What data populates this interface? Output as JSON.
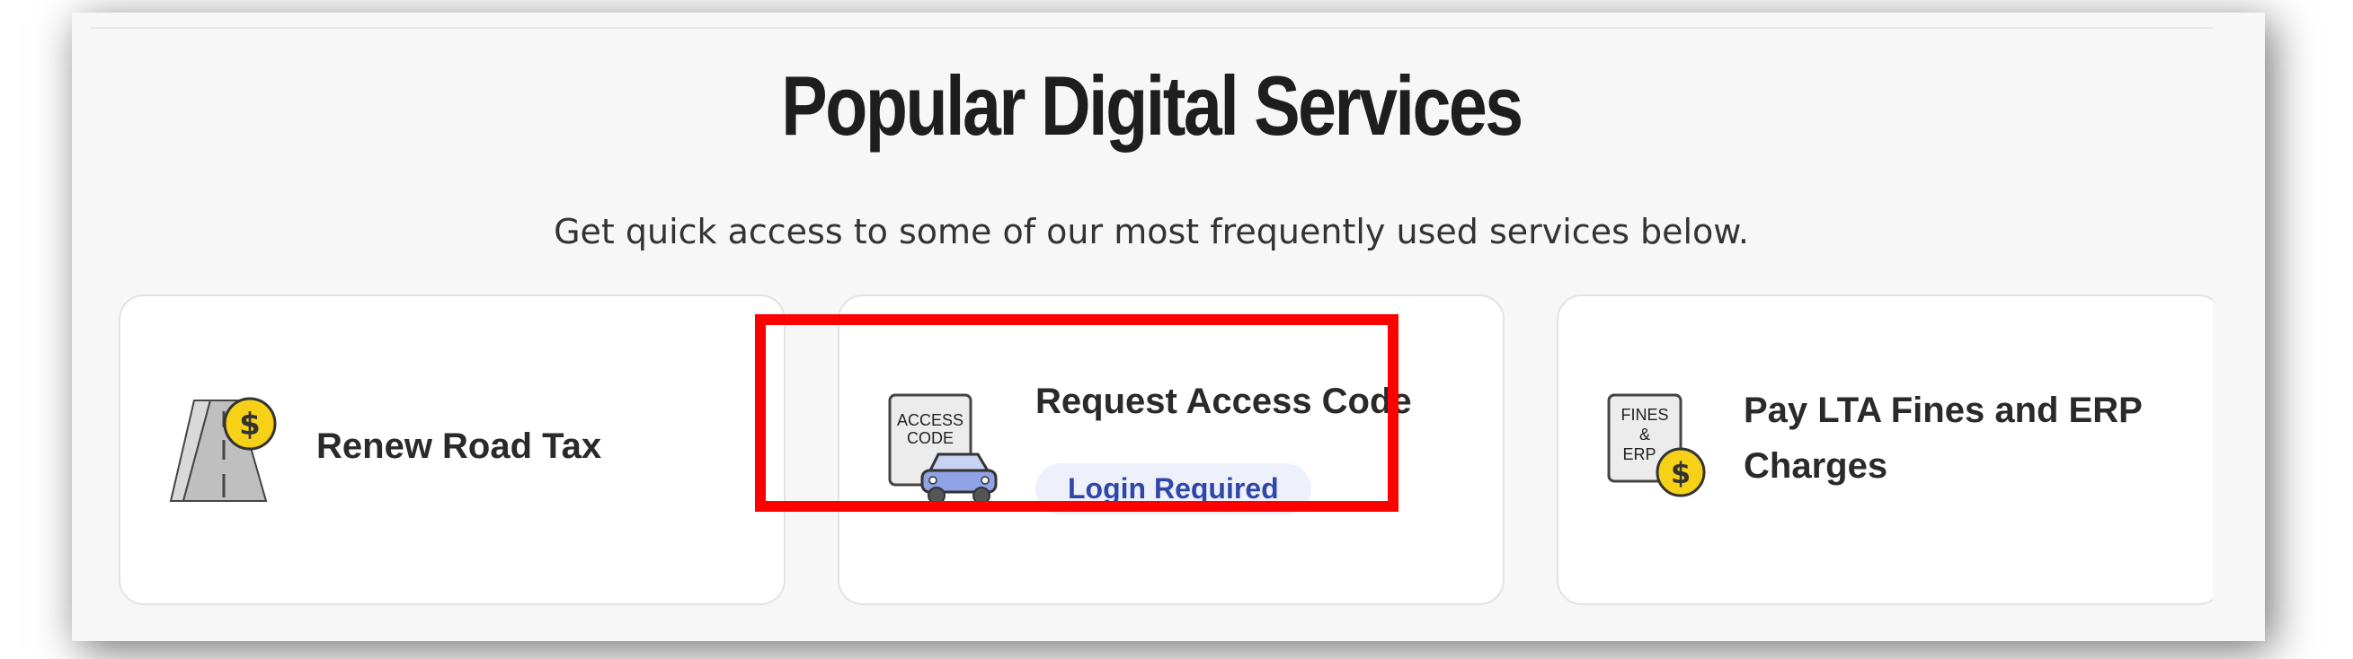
{
  "section": {
    "title": "Popular Digital Services",
    "subtitle": "Get quick access to some of our most frequently used services below."
  },
  "cards": [
    {
      "label": "Renew Road Tax",
      "icon": "road-tax-icon"
    },
    {
      "label": "Request Access Code",
      "badge": "Login Required",
      "icon": "access-code-car-icon",
      "icon_text": "ACCESS CODE"
    },
    {
      "label_line1": "Pay LTA Fines and ERP",
      "label_line2": "Charges",
      "icon": "fines-erp-icon",
      "icon_text": "FINES & ERP"
    }
  ],
  "colors": {
    "highlight": "#ff0000",
    "badge_bg": "#eef1fc",
    "badge_text": "#2f47a8",
    "coin": "#f7d117"
  }
}
